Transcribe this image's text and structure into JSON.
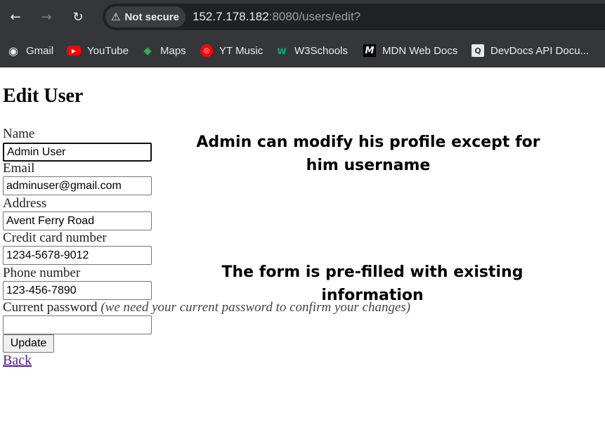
{
  "browser": {
    "back_icon": "←",
    "forward_icon": "→",
    "reload_icon": "↻",
    "security_label": "Not secure",
    "security_icon": "⚠",
    "url_host": "152.7.178.182",
    "url_rest": ":8080/users/edit?"
  },
  "bookmarks": [
    {
      "label": "Gmail",
      "icon": "globe-icon",
      "glyph": "◉",
      "color": "#e8eaed"
    },
    {
      "label": "YouTube",
      "icon": "youtube-icon",
      "glyph": "▶",
      "color": "#ff0000"
    },
    {
      "label": "Maps",
      "icon": "maps-pin-icon",
      "glyph": "◆",
      "color": "#34a853"
    },
    {
      "label": "YT Music",
      "icon": "yt-music-icon",
      "glyph": "◎",
      "color": "#ff0000"
    },
    {
      "label": "W3Schools",
      "icon": "w3schools-icon",
      "glyph": "w",
      "color": "#04aa6d"
    },
    {
      "label": "MDN Web Docs",
      "icon": "mdn-icon",
      "glyph": "M",
      "color": "#ffffff"
    },
    {
      "label": "DevDocs API Docu...",
      "icon": "devdocs-icon",
      "glyph": "Q",
      "color": "#e8eaed"
    }
  ],
  "page": {
    "title": "Edit User",
    "fields": {
      "name": {
        "label": "Name",
        "value": "Admin User"
      },
      "email": {
        "label": "Email",
        "value": "adminuser@gmail.com"
      },
      "address": {
        "label": "Address",
        "value": "Avent Ferry Road"
      },
      "credit_card": {
        "label": "Credit card number",
        "value": "1234-5678-9012"
      },
      "phone": {
        "label": "Phone number",
        "value": "123-456-7890"
      },
      "password": {
        "label": "Current password",
        "hint": "(we need your current password to confirm your changes)",
        "value": ""
      }
    },
    "update_label": "Update",
    "back_label": "Back"
  },
  "annotations": {
    "first": "Admin can modify his profile except for him username",
    "second": "The form is pre-filled with existing information"
  }
}
